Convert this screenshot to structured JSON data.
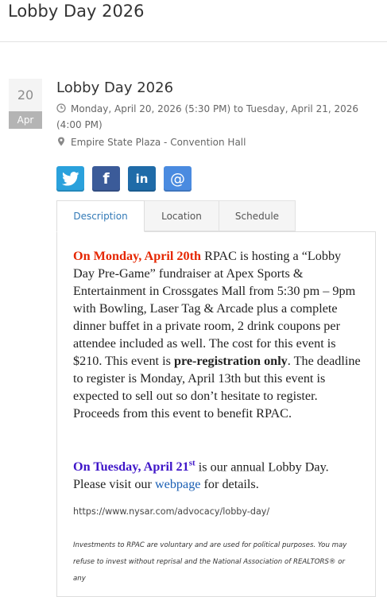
{
  "page": {
    "title": "Lobby Day 2026"
  },
  "event": {
    "title": "Lobby Day 2026",
    "day": "20",
    "month": "Apr",
    "time_line1": "Monday, April 20, 2026 (5:30 PM) to Tuesday, April 21, 2026",
    "time_line2": "(4:00 PM)",
    "location": "Empire State Plaza - Convention Hall"
  },
  "share": {
    "twitter_color": "#2aa1dc",
    "facebook_color": "#3b5b99",
    "linkedin_color": "#1f6ba8",
    "email_color": "#4a8be0",
    "facebook_glyph": "f",
    "linkedin_glyph": "in",
    "email_glyph": "@"
  },
  "tabs": [
    "Description",
    "Location",
    "Schedule"
  ],
  "description": {
    "p1_red": "On Monday, April 20th",
    "p1_a": " RPAC is hosting a “Lobby Day Pre-Game” fundraiser at Apex Sports & Entertainment in Crossgates Mall from 5:30 pm – 9pm with Bowling, Laser Tag & Arcade plus a complete dinner buffet in a private room, 2 drink coupons per attendee included as well. The cost for this event is $210. This event is ",
    "p1_bold": "pre-registration only",
    "p1_b": ". The deadline to register is Monday, April 13th but this event is expected to sell out so don’t hesitate to register. Proceeds from this event to benefit RPAC.",
    "p2_blue": "On Tuesday, April 21",
    "p2_sup": "st",
    "p2_a": "  is our annual Lobby Day. Please visit our ",
    "p2_link": "webpage",
    "p2_b": "  for details.",
    "url": "https://www.nysar.com/advocacy/lobby-day/",
    "disclaimer": "Investments to RPAC are voluntary and are used for political purposes. You may refuse to invest without reprisal and the National Association of REALTORS® or any"
  }
}
